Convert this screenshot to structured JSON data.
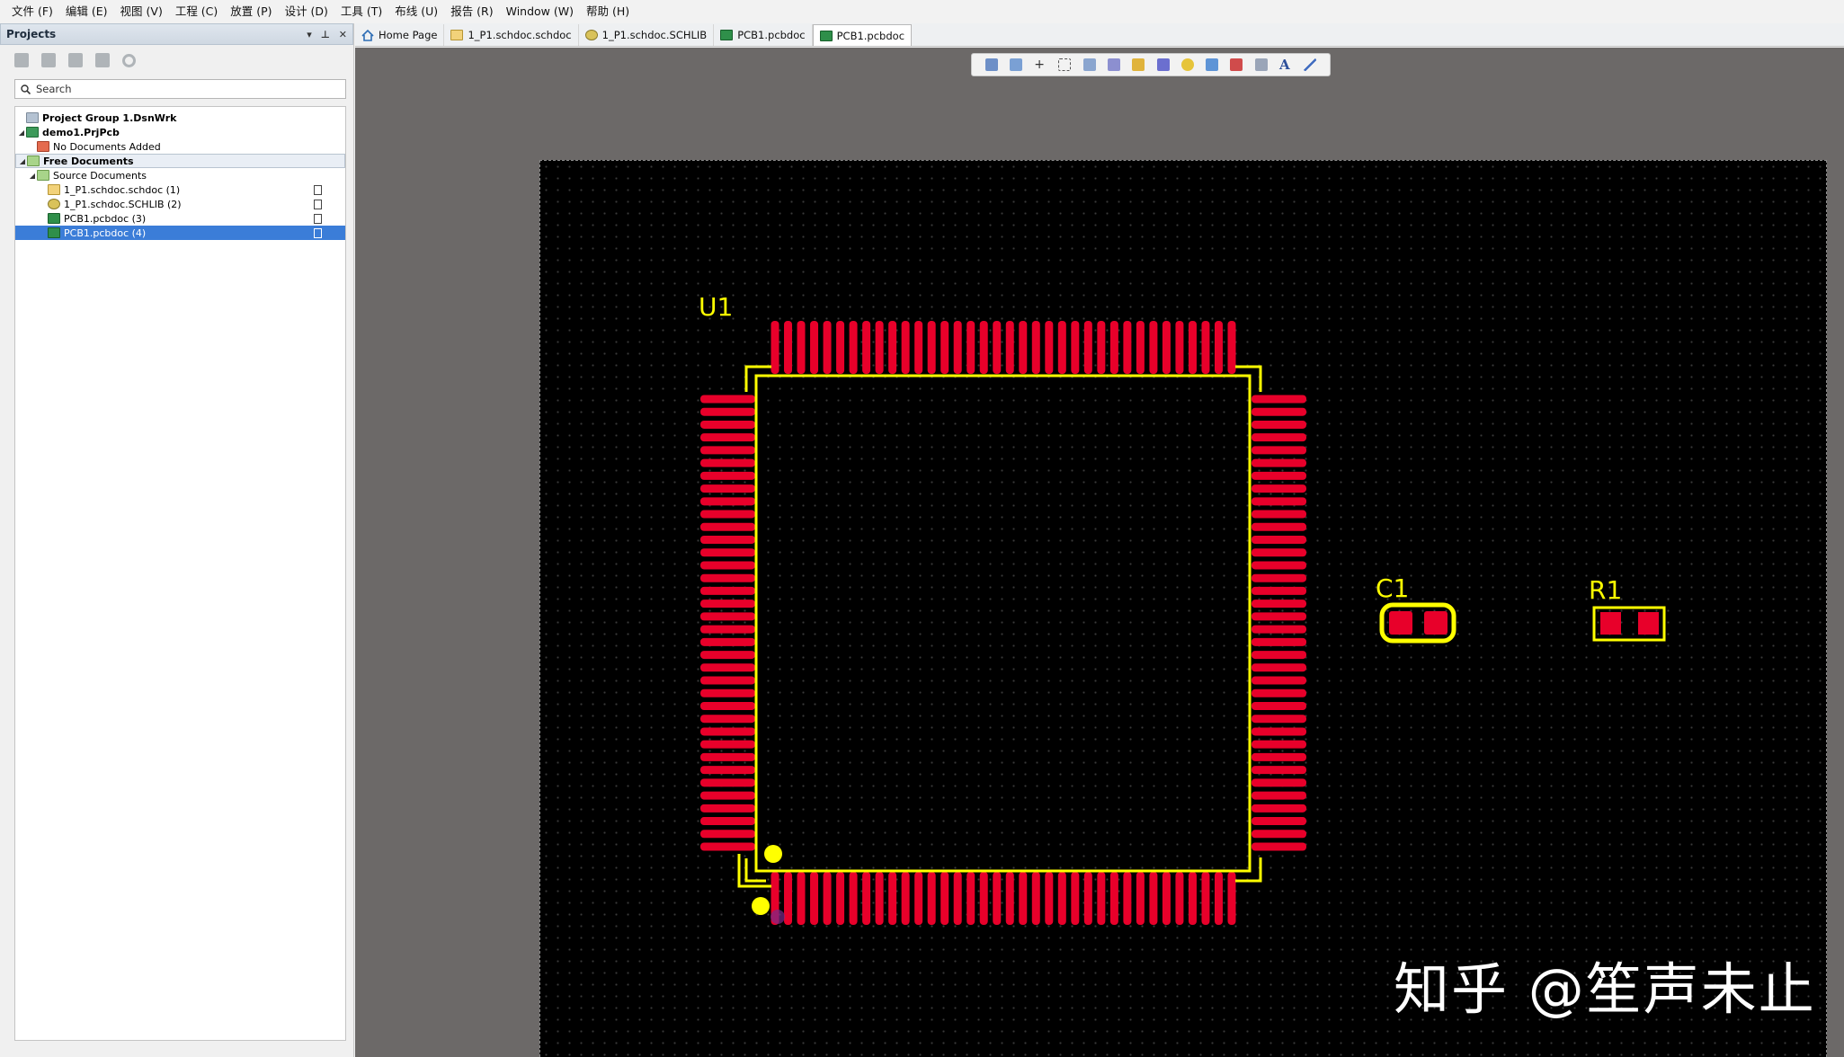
{
  "menubar": {
    "items": [
      "文件 (F)",
      "编辑 (E)",
      "视图 (V)",
      "工程 (C)",
      "放置 (P)",
      "设计 (D)",
      "工具 (T)",
      "布线 (U)",
      "报告 (R)",
      "Window (W)",
      "帮助 (H)"
    ]
  },
  "panel": {
    "title": "Projects",
    "controls": [
      "▾",
      "📌",
      "✕"
    ],
    "search_placeholder": "Search",
    "tree": [
      {
        "label": "Project Group 1.DsnWrk",
        "bold": true,
        "icon": "project-group-icon"
      },
      {
        "label": "demo1.PrjPcb",
        "bold": true,
        "icon": "pcb-project-icon"
      },
      {
        "label": "No Documents Added",
        "icon": "folder-red-icon"
      },
      {
        "label": "Free Documents",
        "bold": true,
        "icon": "folder-green-icon"
      },
      {
        "label": "Source Documents",
        "icon": "folder-green-icon"
      },
      {
        "label": "1_P1.schdoc.schdoc (1)",
        "icon": "schematic-doc-icon"
      },
      {
        "label": "1_P1.schdoc.SCHLIB (2)",
        "icon": "schlib-doc-icon"
      },
      {
        "label": "PCB1.pcbdoc (3)",
        "icon": "pcb-doc-icon"
      },
      {
        "label": "PCB1.pcbdoc (4)",
        "icon": "pcb-doc-icon"
      }
    ]
  },
  "tabs": [
    {
      "label": "Home Page",
      "icon": "home-icon"
    },
    {
      "label": "1_P1.schdoc.schdoc",
      "icon": "schematic-doc-icon"
    },
    {
      "label": "1_P1.schdoc.SCHLIB",
      "icon": "schlib-doc-icon"
    },
    {
      "label": "PCB1.pcbdoc",
      "icon": "pcb-doc-icon"
    },
    {
      "label": "PCB1.pcbdoc",
      "icon": "pcb-doc-icon",
      "active": true
    }
  ],
  "pcb_toolbar": {
    "tools": [
      "filter-icon",
      "route-icon",
      "cross-icon",
      "select-rect-icon",
      "align-icon",
      "component-icon",
      "interactive-route-icon",
      "diff-pair-icon",
      "via-icon",
      "fill-icon",
      "polygon-icon",
      "dimension-icon",
      "text-icon",
      "line-icon"
    ]
  },
  "canvas": {
    "components": {
      "u1": "U1",
      "c1": "C1",
      "r1": "R1"
    },
    "colors": {
      "pad": "#e8002a",
      "silkscreen": "#ffff00",
      "board": "#000000",
      "workspace": "#6c6968"
    }
  },
  "watermark": "知乎 @笙声未止"
}
